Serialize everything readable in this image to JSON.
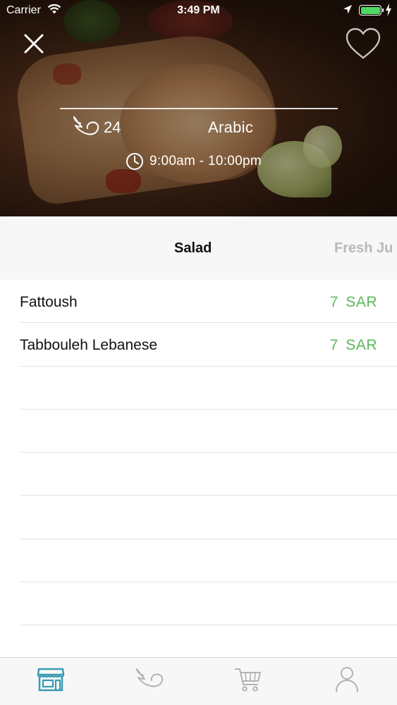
{
  "status_bar": {
    "carrier": "Carrier",
    "time": "3:49 PM",
    "battery_level": 1.0
  },
  "hero": {
    "image": "chicken shawarma wraps with lime",
    "rating": "24",
    "cuisine": "Arabic",
    "hours": "9:00am - 10:00pm",
    "icons": [
      "close-icon",
      "heart-icon",
      "wing-icon",
      "clock-icon"
    ]
  },
  "category_tabs": {
    "items": [
      {
        "label": "Salad",
        "active": true
      },
      {
        "label": "Fresh Ju",
        "active": false
      }
    ]
  },
  "menu_items": [
    {
      "name": "Fattoush",
      "price": "7  SAR"
    },
    {
      "name": "Tabbouleh Lebanese",
      "price": "7  SAR"
    },
    {
      "name": "",
      "price": ""
    },
    {
      "name": "",
      "price": ""
    },
    {
      "name": "",
      "price": ""
    },
    {
      "name": "",
      "price": ""
    },
    {
      "name": "",
      "price": ""
    },
    {
      "name": "",
      "price": ""
    }
  ],
  "bottom_tabs": [
    {
      "icon": "store-icon",
      "active": true
    },
    {
      "icon": "wing-icon",
      "active": false
    },
    {
      "icon": "cart-icon",
      "active": false
    },
    {
      "icon": "profile-icon",
      "active": false
    }
  ],
  "colors": {
    "price_green": "#5cb85c",
    "active_tab_icon": "#3a9bb3",
    "inactive_icon": "#b3b3b3"
  }
}
